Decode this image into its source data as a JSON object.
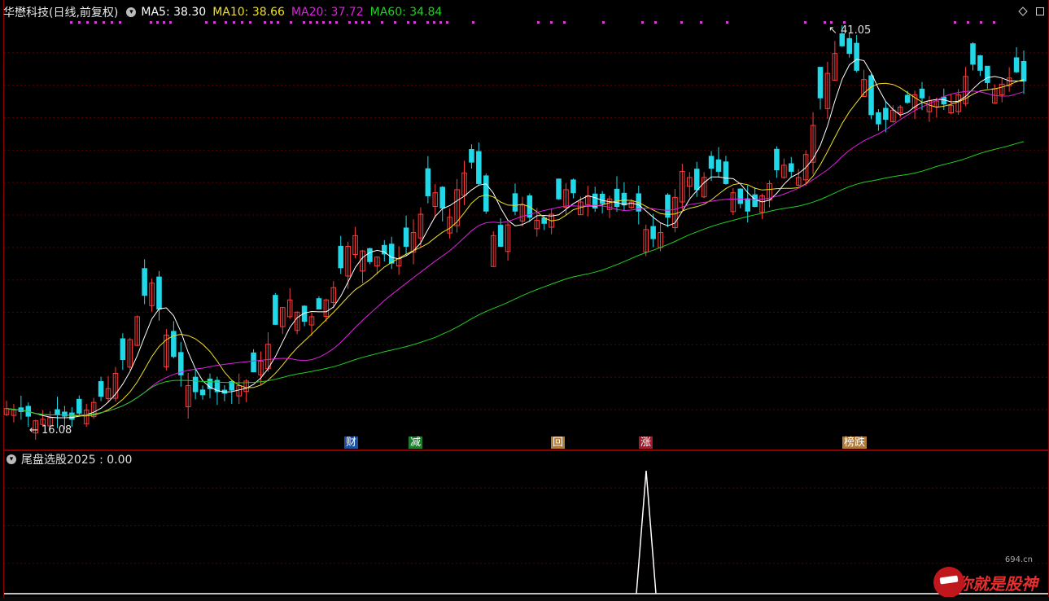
{
  "header": {
    "stock_title": "华懋科技(日线,前复权)",
    "ma5": "MA5: 38.30",
    "ma10": "MA10: 38.66",
    "ma20": "MA20: 37.72",
    "ma60": "MA60: 34.84",
    "colors": {
      "ma5": "#ffffff",
      "ma10": "#f0e020",
      "ma20": "#e020e0",
      "ma60": "#20d020",
      "up": "#ff3c3c",
      "down": "#20d8e8"
    }
  },
  "annotations": {
    "high_label": "41.05",
    "low_label": "16.08"
  },
  "events": [
    {
      "label": "财",
      "color": "#1e4e9e"
    },
    {
      "label": "减",
      "color": "#1e7e2e"
    },
    {
      "label": "回",
      "color": "#b07a3a"
    },
    {
      "label": "涨",
      "color": "#9e1e2e"
    },
    {
      "label": "榜跌",
      "color": "#b07a3a"
    }
  ],
  "indicator": {
    "title": "尾盘选股2025 : 0.00"
  },
  "watermark": {
    "text": "你就是股神",
    "site": "694.cn"
  },
  "chart_data": {
    "type": "candlestick",
    "ylim": [
      15.5,
      42
    ],
    "high": 41.05,
    "low": 16.08,
    "close_series": [
      16.9,
      16.8,
      16.7,
      16.4,
      16.1,
      16.2,
      16.3,
      16.5,
      16.4,
      16.2,
      16.6,
      16.8,
      17.3,
      17.7,
      18.2,
      19.2,
      20.1,
      21.4,
      22.9,
      24.3,
      25.1,
      23.4,
      21.7,
      20.3,
      19.1,
      18.4,
      18.0,
      17.8,
      18.2,
      18.0,
      17.9,
      18.1,
      18.4,
      18.7,
      19.3,
      20.0,
      21.1,
      22.4,
      23.5,
      24.0,
      23.2,
      22.6,
      22.9,
      23.4,
      24.0,
      24.8,
      26.1,
      27.5,
      28.2,
      27.2,
      26.5,
      26.8,
      27.0,
      26.4,
      26.7,
      27.5,
      28.4,
      29.6,
      30.8,
      31.0,
      30.0,
      29.4,
      31.2,
      32.3,
      33.0,
      31.6,
      29.8,
      28.2,
      27.5,
      28.9,
      29.8,
      30.2,
      29.4,
      29.2,
      29.0,
      29.6,
      30.6,
      31.2,
      31.0,
      30.4,
      30.8,
      30.0,
      30.3,
      30.6,
      30.1,
      30.2,
      30.4,
      29.8,
      28.6,
      28.0,
      28.4,
      29.4,
      30.7,
      32.4,
      32.0,
      31.2,
      32.0,
      32.6,
      32.4,
      31.6,
      31.0,
      30.3,
      29.8,
      30.1,
      30.8,
      31.6,
      32.5,
      32.8,
      32.4,
      32.0,
      33.5,
      35.4,
      37.2,
      38.8,
      40.1,
      40.6,
      40.1,
      39.0,
      38.4,
      36.1,
      35.5,
      35.8,
      36.4,
      36.6,
      36.9,
      37.4,
      37.2,
      37.0,
      37.0,
      36.8,
      36.7,
      37.4,
      38.6,
      39.4,
      39.0,
      38.2,
      37.8,
      38.1,
      38.5,
      38.9,
      38.3
    ]
  }
}
